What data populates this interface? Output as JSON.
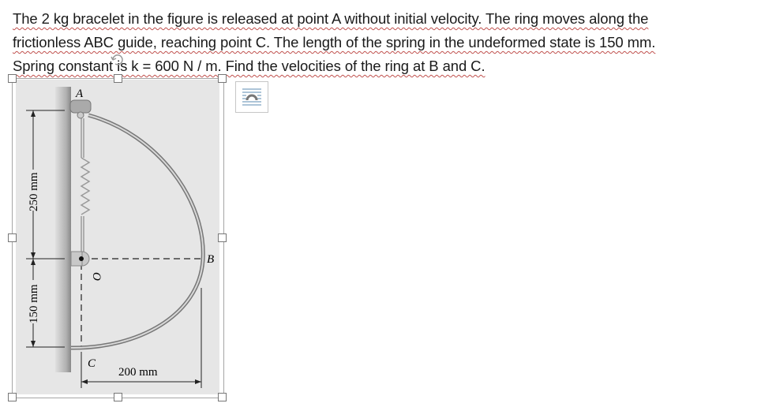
{
  "document": {
    "paragraph_lines": [
      "The 2 kg bracelet in the figure is released at point A without initial velocity. The ring moves along the",
      "frictionless ABC guide, reaching point C. The length of the spring in the undeformed state is 150 mm.",
      "Spring constant is k = 600 N / m. Find the velocities of the ring at B and C."
    ]
  },
  "figure": {
    "labels": {
      "A": "A",
      "B": "B",
      "C": "C",
      "O": "O"
    },
    "dimensions": {
      "vertical_top": "250 mm",
      "vertical_bottom": "150 mm",
      "horizontal": "200 mm"
    },
    "colors": {
      "background": "#e6e6e6",
      "guide": "#8c8c8c",
      "wall": "#b5b5b5"
    }
  },
  "toolbar": {
    "layout_options_icon": "layout-options-icon"
  }
}
